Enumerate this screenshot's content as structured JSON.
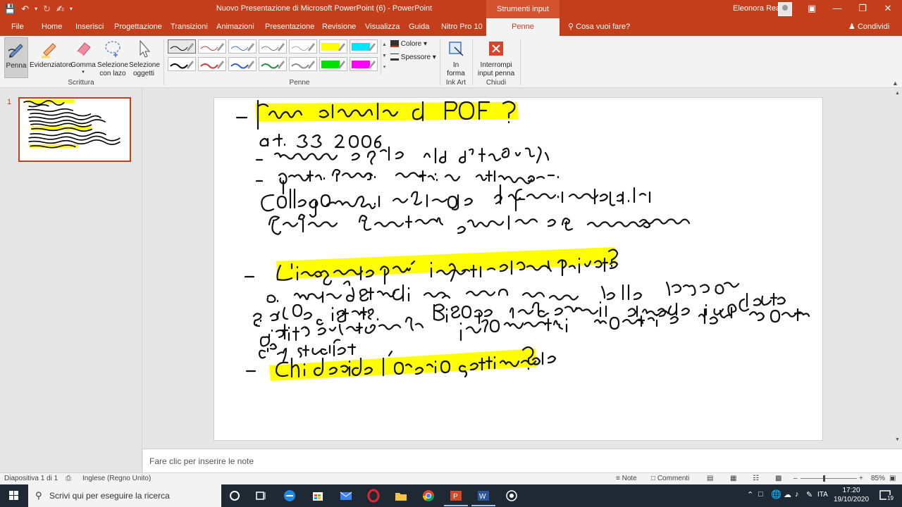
{
  "titlebar": {
    "title": "Nuovo Presentazione di Microsoft PowerPoint (6)  -  PowerPoint",
    "context_tab": "Strumenti input penna",
    "user": "Eleonora Rea"
  },
  "tabs": [
    "File",
    "Home",
    "Inserisci",
    "Progettazione",
    "Transizioni",
    "Animazioni",
    "Presentazione",
    "Revisione",
    "Visualizza",
    "Guida",
    "Nitro Pro 10",
    "Penne"
  ],
  "active_tab": "Penne",
  "tell_me": "Cosa vuoi fare?",
  "share": "Condividi",
  "ribbon": {
    "scrittura": {
      "label": "Scrittura",
      "penna": "Penna",
      "evidenziatore": "Evidenziatore",
      "gomma": "Gomma",
      "selezione_lazo_1": "Selezione",
      "selezione_lazo_2": "con lazo",
      "selezione_oggetti_1": "Selezione",
      "selezione_oggetti_2": "oggetti"
    },
    "penne": {
      "label": "Penne",
      "colore": "Colore",
      "spessore": "Spessore",
      "pen_colors_row1": [
        "#000000",
        "#d13438",
        "#4472c4",
        "#767676",
        "#a6a6a6",
        "#ffff00",
        "#00e5ff"
      ],
      "pen_colors_row2": [
        "#000000",
        "#d13438",
        "#2e5fbf",
        "#1e8a3c",
        "#8c8c8c",
        "#00e000",
        "#ff00ff"
      ]
    },
    "inkart": {
      "label": "Ink Art",
      "in_forma_1": "In",
      "in_forma_2": "forma"
    },
    "chiudi": {
      "label": "Chiudi",
      "interrompi_1": "Interrompi",
      "interrompi_2": "input penna"
    }
  },
  "slide_panel": {
    "number": "1"
  },
  "notes": {
    "placeholder": "Fare clic per inserire le note"
  },
  "statusbar": {
    "slide_info": "Diapositiva 1 di 1",
    "language": "Inglese (Regno Unito)",
    "note": "Note",
    "commenti": "Commenti",
    "zoom": "85%"
  },
  "taskbar": {
    "search_placeholder": "Scrivi qui per eseguire la ricerca",
    "lang": "ITA",
    "time": "17:20",
    "date": "19/10/2020",
    "notifications": "19"
  },
  "colors": {
    "accent": "#c43e1c",
    "highlight": "#ffff00"
  }
}
